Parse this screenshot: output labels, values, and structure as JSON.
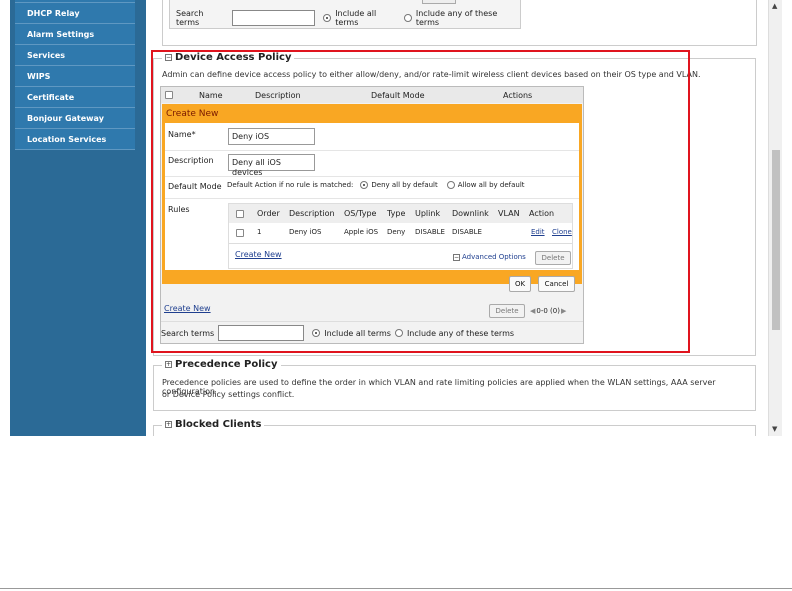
{
  "sidebar": {
    "items": [
      {
        "label": ""
      },
      {
        "label": "DHCP Relay"
      },
      {
        "label": "Alarm Settings"
      },
      {
        "label": "Services"
      },
      {
        "label": "WIPS"
      },
      {
        "label": "Certificate"
      },
      {
        "label": "Bonjour Gateway"
      },
      {
        "label": "Location Services"
      }
    ]
  },
  "top_search": {
    "label": "Search terms",
    "value": "",
    "include_all": "Include all terms",
    "include_any": "Include any of these terms"
  },
  "device_access_policy": {
    "title": "Device Access Policy",
    "toggle": "−",
    "description": "Admin can define device access policy to either allow/deny, and/or rate-limit wireless client devices based on their OS type and VLAN.",
    "columns": [
      "Name",
      "Description",
      "Default Mode",
      "Actions"
    ],
    "create_new_title": "Create New",
    "form": {
      "name_label": "Name*",
      "name_value": "Deny iOS",
      "desc_label": "Description",
      "desc_value": "Deny all iOS devices",
      "mode_label": "Default Mode",
      "mode_prompt": "Default Action if no rule is matched:",
      "mode_deny": "Deny all by default",
      "mode_allow": "Allow all by default",
      "rules_label": "Rules"
    },
    "rules": {
      "columns": [
        "Order",
        "Description",
        "OS/Type",
        "Type",
        "Uplink",
        "Downlink",
        "VLAN",
        "Action"
      ],
      "rows": [
        {
          "order": "1",
          "description": "Deny iOS",
          "os": "Apple iOS",
          "type": "Deny",
          "uplink": "DISABLE",
          "downlink": "DISABLE",
          "vlan": "",
          "edit": "Edit",
          "clone": "Clone"
        }
      ],
      "create_new": "Create New",
      "advanced": "Advanced Options",
      "delete": "Delete"
    },
    "ok": "OK",
    "cancel": "Cancel",
    "create_new_link": "Create New",
    "delete_button": "Delete",
    "pager": "0-0 (0)",
    "search_label": "Search terms",
    "search_value": "",
    "include_all": "Include all terms",
    "include_any": "Include any of these terms"
  },
  "precedence_policy": {
    "title": "Precedence Policy",
    "toggle": "+",
    "line1": "Precedence policies are used to define the order in which VLAN and rate limiting policies are applied when the WLAN settings, AAA server configuration",
    "line2": "or Device Policy settings conflict."
  },
  "blocked_clients": {
    "title": "Blocked Clients",
    "toggle": "+"
  },
  "scrollbar": {
    "up": "▲",
    "down": "▼"
  }
}
